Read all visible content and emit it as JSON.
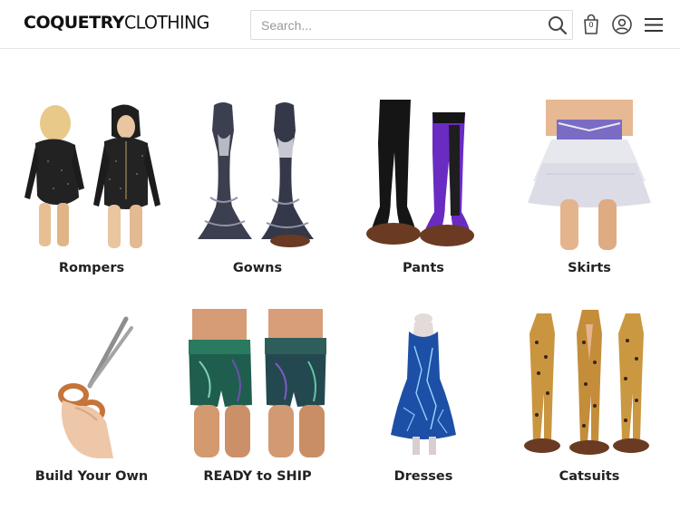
{
  "header": {
    "logo_bold": "COQUETRY",
    "logo_light": "CLOTHING",
    "search": {
      "placeholder": "Search..."
    },
    "cart": {
      "count": "0",
      "icon": "shopping-bag-icon"
    },
    "account_icon": "user-circle-icon",
    "menu_icon": "hamburger-menu-icon",
    "search_icon": "magnifier-icon"
  },
  "categories": [
    {
      "label": "Rompers"
    },
    {
      "label": "Gowns"
    },
    {
      "label": "Pants"
    },
    {
      "label": "Skirts"
    },
    {
      "label": "Build Your Own"
    },
    {
      "label": "READY to SHIP"
    },
    {
      "label": "Dresses"
    },
    {
      "label": "Catsuits"
    }
  ],
  "colors": {
    "header_border": "#e6e6e6",
    "label_text": "#222222",
    "search_border": "#dcdcdc"
  }
}
